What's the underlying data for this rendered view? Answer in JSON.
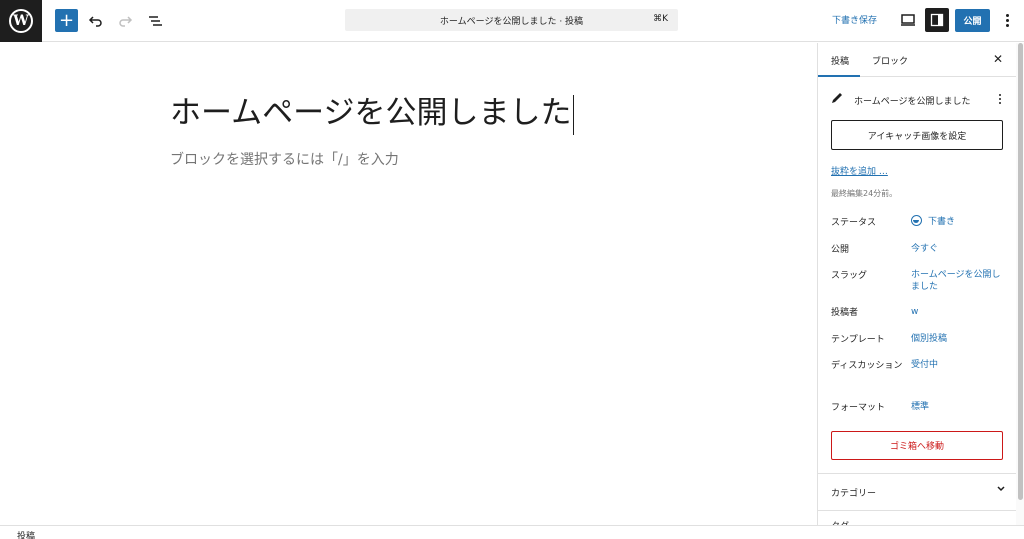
{
  "topbar": {
    "logo_text": "W",
    "add_label": "+",
    "command_text": "ホームページを公開しました · 投稿",
    "command_shortcut": "⌘K",
    "save_draft_label": "下書き保存",
    "publish_label": "公開"
  },
  "editor": {
    "post_title": "ホームページを公開しました",
    "block_placeholder": "ブロックを選択するには「/」を入力"
  },
  "sidebar": {
    "tabs": [
      {
        "label": "投稿"
      },
      {
        "label": "ブロック"
      }
    ],
    "close_label": "✕",
    "post_card_title": "ホームページを公開しました",
    "featured_image_label": "アイキャッチ画像を設定",
    "excerpt_link": "抜粋を追加 …",
    "last_edited": "最終編集24分前。",
    "meta": [
      {
        "label": "ステータス",
        "value": "下書き"
      },
      {
        "label": "公開",
        "value": "今すぐ"
      },
      {
        "label": "スラッグ",
        "value": "ホームページを公開しました"
      },
      {
        "label": "投稿者",
        "value": "w"
      },
      {
        "label": "テンプレート",
        "value": "個別投稿"
      },
      {
        "label": "ディスカッション",
        "value": "受付中"
      },
      {
        "label": "フォーマット",
        "value": "標準"
      }
    ],
    "trash_label": "ゴミ箱へ移動",
    "categories_label": "カテゴリー",
    "tags_partial": "タグ"
  },
  "footer": {
    "breadcrumb": "投稿"
  },
  "colors": {
    "accent": "#2271b1",
    "danger": "#cc1818",
    "dark": "#1e1e1e"
  }
}
